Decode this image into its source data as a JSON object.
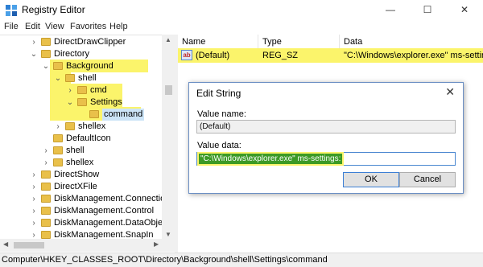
{
  "window": {
    "title": "Registry Editor",
    "minimize_glyph": "—",
    "maximize_glyph": "☐",
    "close_glyph": "✕"
  },
  "menu": [
    "File",
    "Edit",
    "View",
    "Favorites",
    "Help"
  ],
  "tree": [
    {
      "label": "DirectDrawClipper",
      "chev": "›"
    },
    {
      "label": "Directory",
      "chev": "⌄"
    },
    {
      "label": "Background",
      "chev": "⌄"
    },
    {
      "label": "shell",
      "chev": "⌄"
    },
    {
      "label": "cmd",
      "chev": "›"
    },
    {
      "label": "Settings",
      "chev": "⌄"
    },
    {
      "label": "command",
      "chev": ""
    },
    {
      "label": "shellex",
      "chev": "›"
    },
    {
      "label": "DefaultIcon",
      "chev": ""
    },
    {
      "label": "shell",
      "chev": "›"
    },
    {
      "label": "shellex",
      "chev": "›"
    },
    {
      "label": "DirectShow",
      "chev": "›"
    },
    {
      "label": "DirectXFile",
      "chev": "›"
    },
    {
      "label": "DiskManagement.Connection",
      "chev": "›"
    },
    {
      "label": "DiskManagement.Control",
      "chev": "›"
    },
    {
      "label": "DiskManagement.DataObject",
      "chev": "›"
    },
    {
      "label": "DiskManagement.SnapIn",
      "chev": "›"
    }
  ],
  "list": {
    "columns": [
      "Name",
      "Type",
      "Data"
    ],
    "rows": [
      {
        "name": "(Default)",
        "type": "REG_SZ",
        "data": "\"C:\\Windows\\explorer.exe\" ms-settings:"
      }
    ]
  },
  "status": "Computer\\HKEY_CLASSES_ROOT\\Directory\\Background\\shell\\Settings\\command",
  "dialog": {
    "title": "Edit String",
    "close_glyph": "✕",
    "value_name_label": "Value name:",
    "value_name": "(Default)",
    "value_data_label": "Value data:",
    "value_data": "\"C:\\Windows\\explorer.exe\" ms-settings:",
    "ok": "OK",
    "cancel": "Cancel"
  },
  "icons": {
    "value_type": "ab"
  },
  "colors": {
    "highlight": "#fbf46b",
    "selection": "#3c9a25",
    "folder": "#e9c04a"
  }
}
